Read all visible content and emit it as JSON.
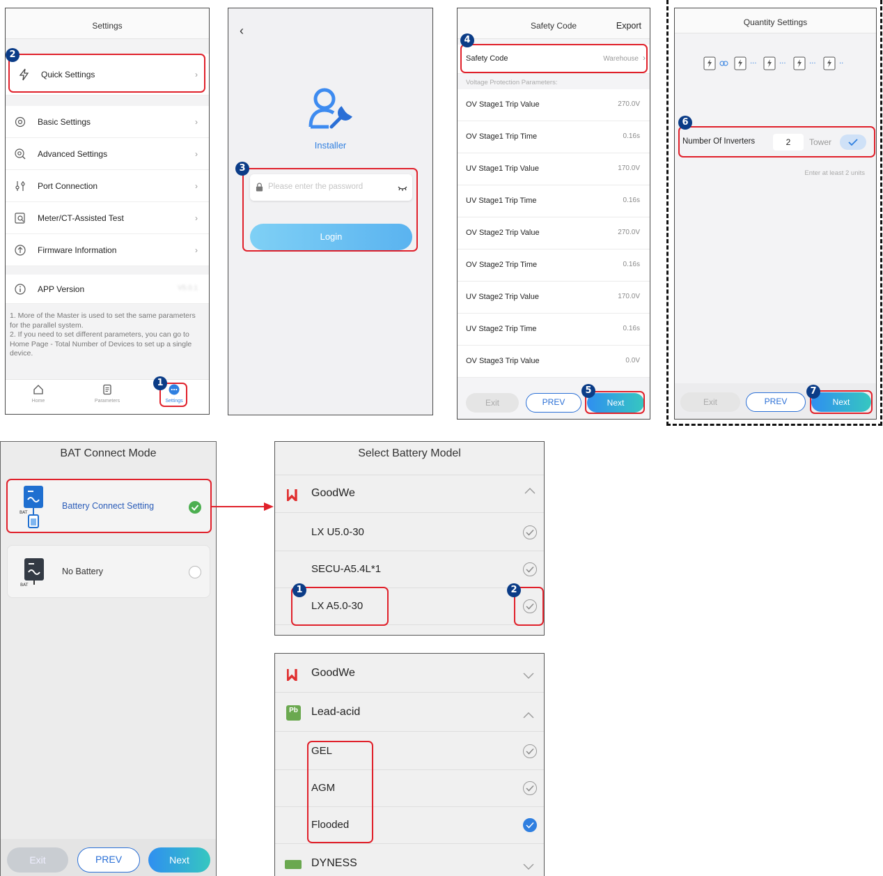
{
  "p1": {
    "title": "Settings",
    "quick": "Quick Settings",
    "items": [
      "Basic Settings",
      "Advanced Settings",
      "Port Connection",
      "Meter/CT-Assisted Test",
      "Firmware Information"
    ],
    "app_version_label": "APP Version",
    "app_version_value": "V5.0.1",
    "note1": "1. More of the Master is used to set the same parameters for the parallel system.",
    "note2": "2. If you need to set different parameters, you can go to Home Page - Total Number of Devices to set up a single device.",
    "nav": [
      "Home",
      "Parameters",
      "Settings"
    ]
  },
  "p2": {
    "role": "Installer",
    "password_placeholder": "Please enter the password",
    "login": "Login"
  },
  "p3": {
    "title": "Safety Code",
    "export": "Export",
    "safety_label": "Safety Code",
    "safety_value": "Warehouse",
    "section": "Voltage Protection Parameters:",
    "params": [
      {
        "k": "OV Stage1 Trip Value",
        "v": "270.0V"
      },
      {
        "k": "OV Stage1 Trip Time",
        "v": "0.16s"
      },
      {
        "k": "UV Stage1 Trip Value",
        "v": "170.0V"
      },
      {
        "k": "UV Stage1 Trip Time",
        "v": "0.16s"
      },
      {
        "k": "OV Stage2 Trip Value",
        "v": "270.0V"
      },
      {
        "k": "OV Stage2 Trip Time",
        "v": "0.16s"
      },
      {
        "k": "UV Stage2 Trip Value",
        "v": "170.0V"
      },
      {
        "k": "UV Stage2 Trip Time",
        "v": "0.16s"
      },
      {
        "k": "OV Stage3 Trip Value",
        "v": "0.0V"
      }
    ],
    "exit": "Exit",
    "prev": "PREV",
    "next": "Next"
  },
  "p4": {
    "title": "Quantity Settings",
    "inverters_label": "Number Of Inverters",
    "inverters_value": "2",
    "tower": "Tower",
    "hint": "Enter at least 2 units",
    "exit": "Exit",
    "prev": "PREV",
    "next": "Next"
  },
  "p5": {
    "title": "BAT Connect Mode",
    "opt1": "Battery Connect Setting",
    "opt2": "No Battery",
    "icon_text": "BAT",
    "exit": "Exit",
    "prev": "PREV",
    "next": "Next"
  },
  "p6": {
    "title": "Select Battery Model",
    "brand": "GoodWe",
    "models": [
      "LX U5.0-30",
      "SECU-A5.4L*1",
      "LX A5.0-30"
    ]
  },
  "p7": {
    "brand1": "GoodWe",
    "brand2": "Lead-acid",
    "pb_icon": "Pb",
    "types": [
      "GEL",
      "AGM",
      "Flooded"
    ],
    "brand3": "DYNESS"
  },
  "badges": [
    "1",
    "2",
    "3",
    "4",
    "5",
    "6",
    "7"
  ],
  "colors": {
    "accent": "#2f7fe0",
    "highlight": "#e0202a",
    "badge": "#0b3c87",
    "check_green": "#4caf50",
    "brand_red": "#e03030"
  }
}
